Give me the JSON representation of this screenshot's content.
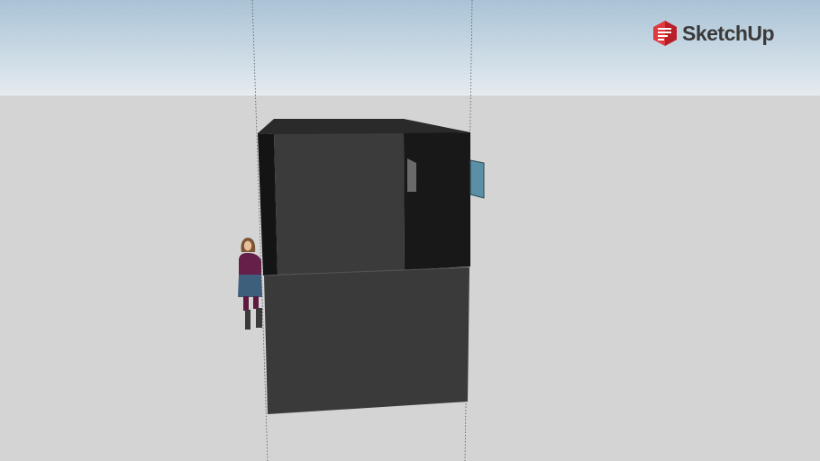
{
  "brand": {
    "name": "SketchUp",
    "icon": "sketchup-logo-icon",
    "icon_color": "#e0393e",
    "text_color": "#3a3a3a"
  },
  "scene": {
    "sky_color_top": "#a9c3d6",
    "sky_color_bottom": "#e6ecf0",
    "ground_color": "#d4d4d4",
    "model_color": "#1b1b1b",
    "window_color": "#5b8fa5"
  }
}
